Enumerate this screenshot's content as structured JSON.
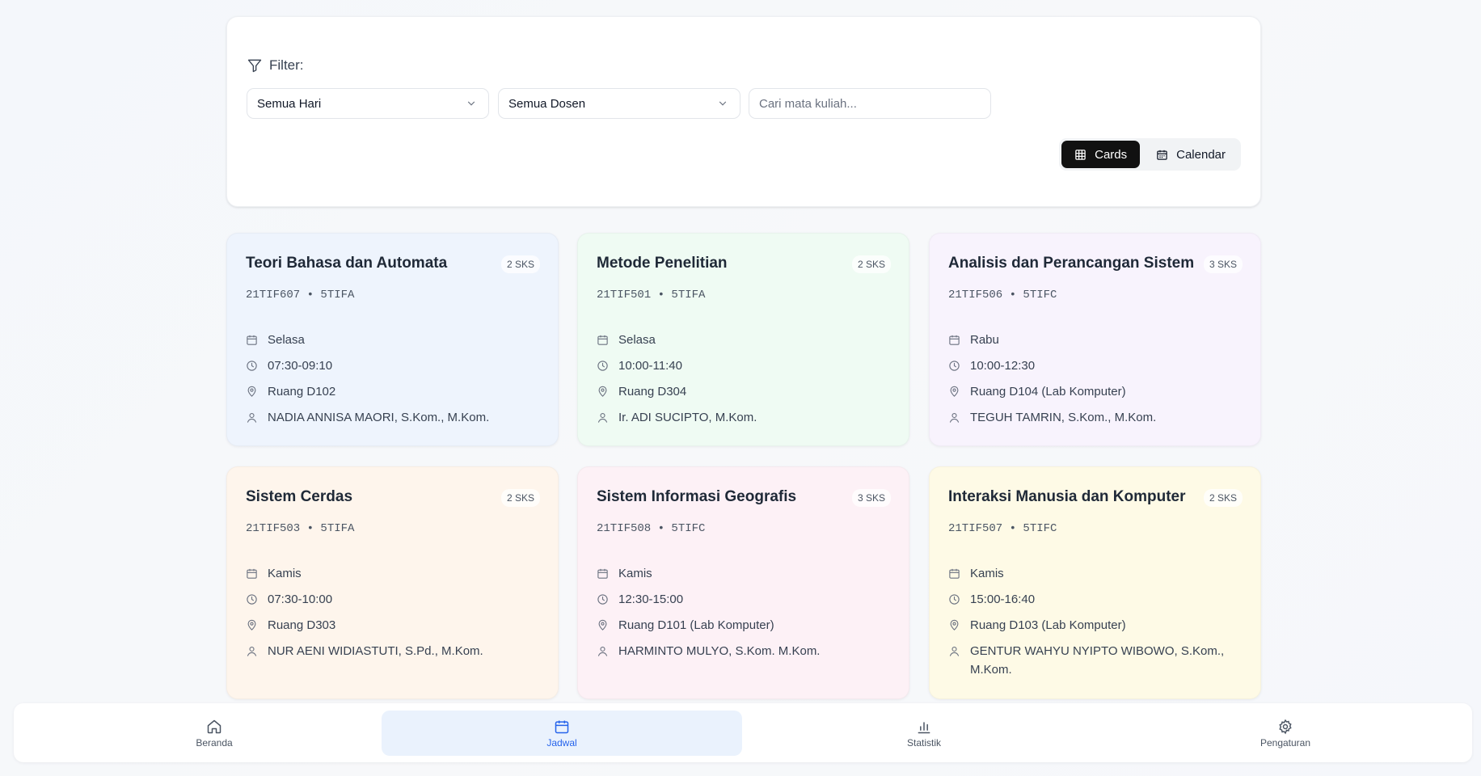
{
  "filter": {
    "label": "Filter:",
    "day_select": "Semua Hari",
    "lecturer_select": "Semua Dosen",
    "search_placeholder": "Cari mata kuliah...",
    "view_cards": "Cards",
    "view_calendar": "Calendar"
  },
  "courses": [
    {
      "title": "Teori Bahasa dan Automata",
      "sks": "2 SKS",
      "code": "21TIF607 • 5TIFA",
      "day": "Selasa",
      "time": "07:30-09:10",
      "room": "Ruang D102",
      "lecturer": "NADIA ANNISA MAORI, S.Kom., M.Kom.",
      "bg": "#eef4fd"
    },
    {
      "title": "Metode Penelitian",
      "sks": "2 SKS",
      "code": "21TIF501 • 5TIFA",
      "day": "Selasa",
      "time": "10:00-11:40",
      "room": "Ruang D304",
      "lecturer": "Ir. ADI SUCIPTO, M.Kom.",
      "bg": "#effbf3"
    },
    {
      "title": "Analisis dan Perancangan Sistem",
      "sks": "3 SKS",
      "code": "21TIF506 • 5TIFC",
      "day": "Rabu",
      "time": "10:00-12:30",
      "room": "Ruang D104 (Lab Komputer)",
      "lecturer": "TEGUH TAMRIN, S.Kom., M.Kom.",
      "bg": "#f8f3fd"
    },
    {
      "title": "Sistem Cerdas",
      "sks": "2 SKS",
      "code": "21TIF503 • 5TIFA",
      "day": "Kamis",
      "time": "07:30-10:00",
      "room": "Ruang D303",
      "lecturer": "NUR AENI WIDIASTUTI, S.Pd., M.Kom.",
      "bg": "#fef5ec"
    },
    {
      "title": "Sistem Informasi Geografis",
      "sks": "3 SKS",
      "code": "21TIF508 • 5TIFC",
      "day": "Kamis",
      "time": "12:30-15:00",
      "room": "Ruang D101 (Lab Komputer)",
      "lecturer": "HARMINTO MULYO, S.Kom. M.Kom.",
      "bg": "#fdf1f6"
    },
    {
      "title": "Interaksi Manusia dan Komputer",
      "sks": "2 SKS",
      "code": "21TIF507 • 5TIFC",
      "day": "Kamis",
      "time": "15:00-16:40",
      "room": "Ruang D103 (Lab Komputer)",
      "lecturer": "GENTUR WAHYU NYIPTO WIBOWO, S.Kom., M.Kom.",
      "bg": "#fefae6"
    }
  ],
  "nav": {
    "home": "Beranda",
    "schedule": "Jadwal",
    "stats": "Statistik",
    "settings": "Pengaturan"
  },
  "accent": "#2563eb"
}
